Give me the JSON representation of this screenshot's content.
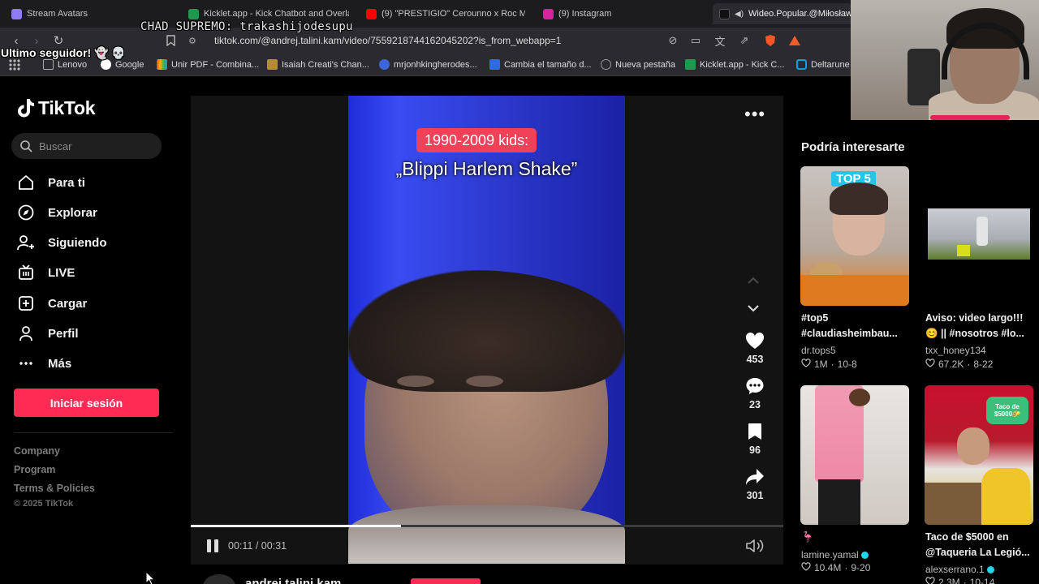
{
  "browser": {
    "tabs": [
      {
        "title": "Stream Avatars",
        "color": "#8e7cf6"
      },
      {
        "title": "Kicklet.app - Kick Chatbot and Overla",
        "color": "#1d9a4f"
      },
      {
        "title": "(9) \"PRESTIGIO\" Cerounno x Roc Ma",
        "color": "#ff0000"
      },
      {
        "title": "(9) Instagram",
        "color": "#d6249f"
      },
      {
        "title": "Wideo.Popular.@Miłosław",
        "color": "#111111"
      }
    ],
    "url": "tiktok.com/@andrej.talini.kam/video/7559218744162045202?is_from_webapp=1",
    "bookmarks": [
      {
        "label": "Lenovo",
        "color": "#3b3b3f"
      },
      {
        "label": "Google",
        "color": "#4285f4"
      },
      {
        "label": "Unir PDF - Combina...",
        "color": "#e94e1b"
      },
      {
        "label": "Isaiah Creati's Chan...",
        "color": "#b58b3a"
      },
      {
        "label": "mrjonhkingherodes...",
        "color": "#3a66d9"
      },
      {
        "label": "Cambia el tamaño d...",
        "color": "#2d6ae3"
      },
      {
        "label": "Nueva pestaña",
        "color": "#777777"
      },
      {
        "label": "Kicklet.app - Kick C...",
        "color": "#1d9a4f"
      },
      {
        "label": "Deltarune",
        "color": "#0aa1dd"
      }
    ]
  },
  "overlay": {
    "chad": "CHAD SUPREMO: trakashijodesupu",
    "ultimo": "Ultimo seguidor! 👻 💀"
  },
  "sidebar": {
    "logo": "TikTok",
    "search_placeholder": "Buscar",
    "menu": [
      {
        "label": "Para ti",
        "icon": "home-icon"
      },
      {
        "label": "Explorar",
        "icon": "compass-icon"
      },
      {
        "label": "Siguiendo",
        "icon": "user-follow-icon"
      },
      {
        "label": "LIVE",
        "icon": "live-tv-icon"
      },
      {
        "label": "Cargar",
        "icon": "upload-icon"
      },
      {
        "label": "Perfil",
        "icon": "profile-icon"
      },
      {
        "label": "Más",
        "icon": "more-icon"
      }
    ],
    "login": "Iniciar sesión",
    "footer": [
      "Company",
      "Program",
      "Terms & Policies"
    ],
    "copyright": "© 2025 TikTok"
  },
  "video": {
    "tag": "1990-2009 kids:",
    "caption": "„Blippi Harlem Shake”",
    "likes": "453",
    "comments": "23",
    "saves": "96",
    "shares": "301",
    "time": "00:11 / 00:31",
    "progress": 0.355,
    "author": "andrej.talini.kam",
    "accent": "#fe2c55"
  },
  "recommendations": {
    "title": "Podría interesarte",
    "cards": [
      {
        "title1": "#top5",
        "title2": "#claudiasheimbau...",
        "user": "dr.tops5",
        "likes": "1M",
        "date": "10-8",
        "verified": false
      },
      {
        "title1": "Aviso: video largo!!!",
        "title2": "😊 || #nosotros #lo...",
        "user": "txx_honey134",
        "likes": "67.2K",
        "date": "8-22",
        "verified": false
      },
      {
        "title1": "🦩",
        "title2": "",
        "user": "lamine.yamal",
        "likes": "10.4M",
        "date": "9-20",
        "verified": true
      },
      {
        "title1": "Taco de $5000 en",
        "title2": "@Taqueria La Legió...",
        "user": "alexserrano.1",
        "likes": "2.3M",
        "date": "10-14",
        "verified": true
      }
    ],
    "top5_badge": "TOP 5",
    "taco_badge": "Taco de $5000🌮"
  }
}
